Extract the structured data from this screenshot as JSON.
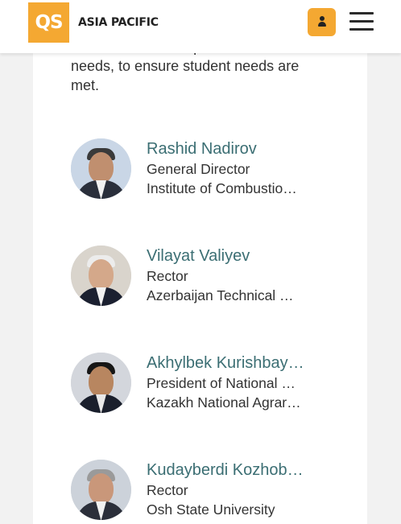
{
  "header": {
    "logo_text": "QS",
    "brand": "ASIA PACIFIC",
    "user_icon": "user-icon",
    "menu_icon": "hamburger-menu-icon",
    "accent_color": "#f4a832"
  },
  "intro_text": "consider the best options based on needs, to ensure student needs are met.",
  "people": [
    {
      "name": "Rashid Nadirov",
      "role": "General Director",
      "org": "Institute of Combustio…"
    },
    {
      "name": "Vilayat Valiyev",
      "role": "Rector",
      "org": "Azerbaijan Technical …"
    },
    {
      "name": "Akhylbek Kurishbay…",
      "role": "President of National …",
      "org": "Kazakh National Agrar…"
    },
    {
      "name": "Kudayberdi Kozhob…",
      "role": "Rector",
      "org": "Osh State University"
    }
  ],
  "colors": {
    "name_color": "#3b6e73",
    "text_color": "#333333"
  }
}
